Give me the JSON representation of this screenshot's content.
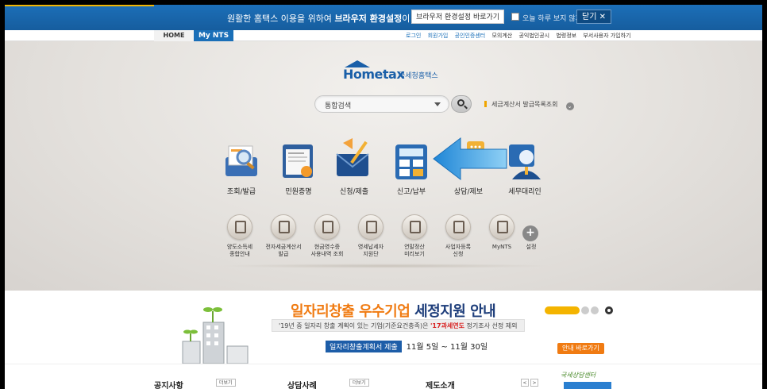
{
  "topbar": {
    "message_pre": "원활한 홈택스 이용을 위하여 ",
    "message_bold": "브라우저 환경설정",
    "message_post": "이 필요합니다.",
    "env_button": "브라우저 환경설정 바로가기",
    "dont_show": "오늘 하루 보지 않기",
    "close_button": "닫기 ✕"
  },
  "nav": {
    "home": "HOME",
    "mynts": "My NTS",
    "links": [
      "로그인",
      "회원가입",
      "공인인증센터",
      "모의계산",
      "공익법인공시",
      "법령정보",
      "부서사용자 가입하기"
    ]
  },
  "logo": {
    "brand": "Hometax",
    "tagline": "국세청홈택스"
  },
  "search": {
    "value": "통합검색"
  },
  "invoice_link": "세금계산서 발급목록조회",
  "main_menu": [
    {
      "label": "조회/발급",
      "icon": "lookup-issue-icon"
    },
    {
      "label": "민원증명",
      "icon": "certificate-icon"
    },
    {
      "label": "신청/제출",
      "icon": "submit-mail-icon"
    },
    {
      "label": "신고/납부",
      "icon": "calculator-icon"
    },
    {
      "label": "상담/제보",
      "icon": "chat-icon"
    },
    {
      "label": "세무대리인",
      "icon": "tax-agent-icon"
    }
  ],
  "sub_menu": [
    {
      "label": "양도소득세\n종합안내"
    },
    {
      "label": "전자세금계산서\n발급"
    },
    {
      "label": "현금영수증\n사용내역 조회"
    },
    {
      "label": "영세납세자\n지원단"
    },
    {
      "label": "연말정산\n미리보기"
    },
    {
      "label": "사업자등록\n신청"
    },
    {
      "label": "MyNTS"
    },
    {
      "label": "설정"
    }
  ],
  "banner": {
    "title_orange": "일자리창출 우수기업 ",
    "title_navy": "세정지원 안내",
    "sub_pre": "'19년 중 일자리 창출 계획이 있는 기업(기준요건충족)은 ",
    "sub_red": "'17과세연도",
    "sub_post": " 정기조사 선정 제외",
    "period_tag": "일자리창출계획서 제출",
    "period": "11월 5일 ~ 11월 30일",
    "button": "안내 바로가기"
  },
  "bottom": {
    "notice": "공지사항",
    "notice_more": "더보기",
    "consult": "상담사례",
    "consult_more": "더보기",
    "system": "제도소개",
    "prev": "<",
    "next": ">",
    "hand": "국세상담센터"
  },
  "colors": {
    "topbar": "#1c6fb8",
    "accent_orange": "#f07b12",
    "navy": "#1d3d7a",
    "arrow_blue": "#2b9be0"
  }
}
